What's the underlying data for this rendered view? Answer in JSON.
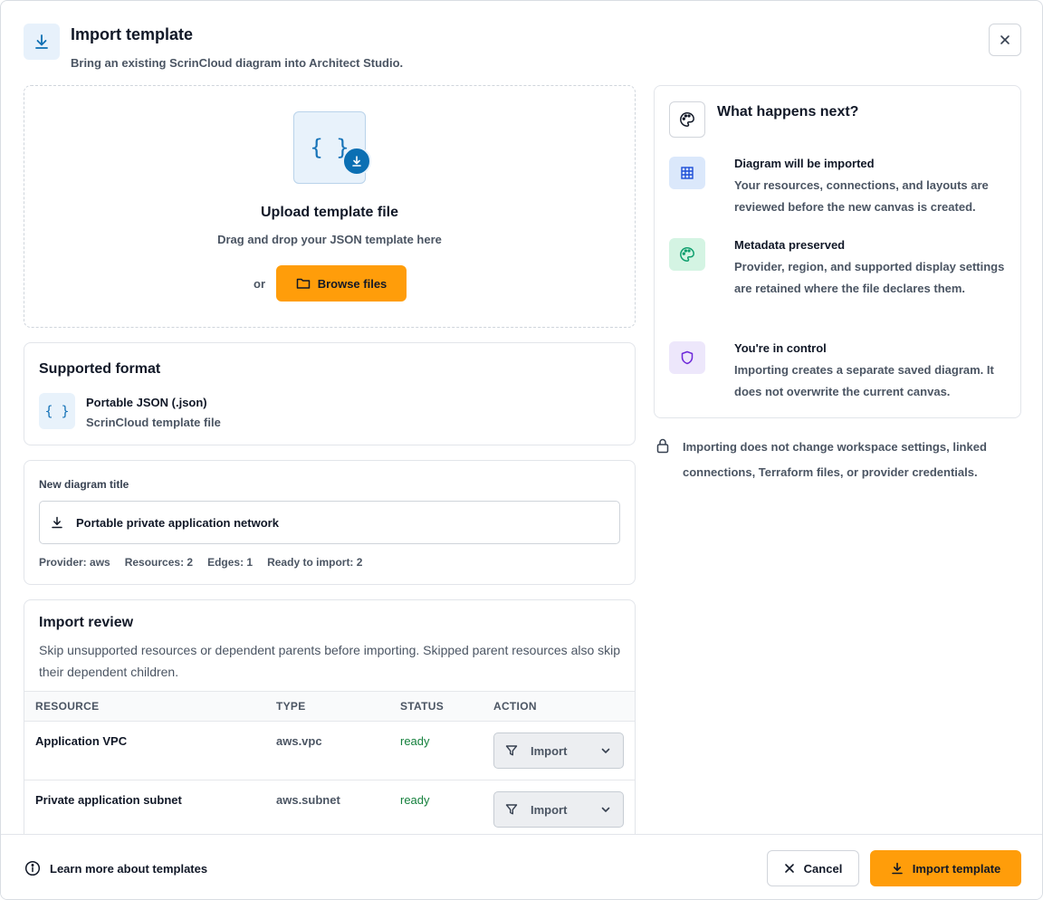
{
  "header": {
    "title": "Import template",
    "subtitle": "Bring an existing ScrinCloud diagram into Architect Studio."
  },
  "upload": {
    "icon_text": "{ }",
    "title": "Upload template file",
    "subtitle": "Drag and drop your JSON template here",
    "or_label": "or",
    "browse_label": "Browse files"
  },
  "format": {
    "heading": "Supported format",
    "icon_text": "{ }",
    "name": "Portable JSON (.json)",
    "description": "ScrinCloud template file"
  },
  "title_field": {
    "label": "New diagram title",
    "value": "Portable private application network",
    "stats": [
      "Provider: aws",
      "Resources: 2",
      "Edges: 1",
      "Ready to import: 2"
    ]
  },
  "review": {
    "heading": "Import review",
    "description": "Skip unsupported resources or dependent parents before importing. Skipped parent resources also skip their dependent children.",
    "columns": [
      "RESOURCE",
      "TYPE",
      "STATUS",
      "ACTION"
    ],
    "rows": [
      {
        "name": "Application VPC",
        "type": "aws.vpc",
        "status": "ready",
        "action": "Import"
      },
      {
        "name": "Private application subnet",
        "type": "aws.subnet",
        "status": "ready",
        "action": "Import"
      }
    ]
  },
  "next": {
    "heading": "What happens next?",
    "steps": [
      {
        "title": "Diagram will be imported",
        "description": "Your resources, connections, and layouts are reviewed before the new canvas is created."
      },
      {
        "title": "Metadata preserved",
        "description": "Provider, region, and supported display settings are retained where the file declares them."
      },
      {
        "title": "You're in control",
        "description": "Importing creates a separate saved diagram. It does not overwrite the current canvas."
      }
    ]
  },
  "note": "Importing does not change workspace settings, linked connections, Terraform files, or provider credentials.",
  "footer": {
    "learn_label": "Learn more about templates",
    "cancel_label": "Cancel",
    "import_label": "Import template"
  },
  "colors": {
    "accent": "#ff9d0a",
    "primary_blue": "#0b6fb3",
    "ready_green": "#15803d"
  }
}
